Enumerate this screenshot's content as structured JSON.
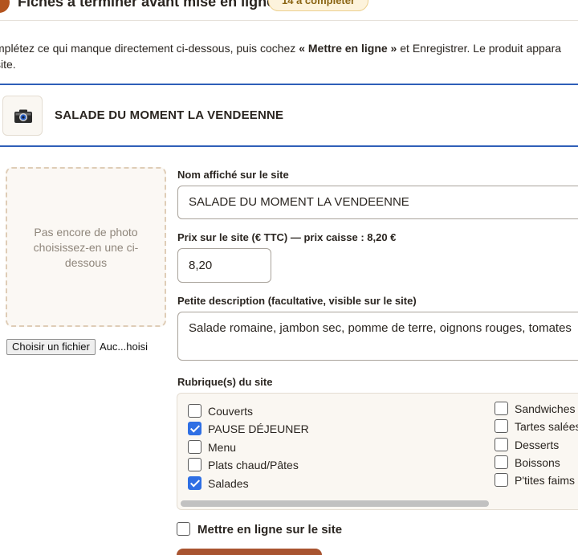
{
  "header": {
    "title": "Fiches à terminer avant mise en ligne",
    "badge": "14 à compléter"
  },
  "instructions": {
    "line1_before": "mplétez ce qui manque directement ci-dessous, puis cochez ",
    "line1_bold": "« Mettre en ligne »",
    "line1_after": " et Enregistrer. Le produit appara",
    "line2": "site."
  },
  "product": {
    "name": "SALADE DU MOMENT LA VENDEENNE",
    "icon": "camera-icon"
  },
  "photo": {
    "placeholder": "Pas encore de photo choisissez-en une ci-dessous",
    "file_button": "Choisir un fichier",
    "file_status": "Auc...hoisi"
  },
  "form": {
    "name_label": "Nom affiché sur le site",
    "name_value": "SALADE DU MOMENT LA VENDEENNE",
    "price_label": "Prix sur le site (€ TTC) — prix caisse : 8,20 €",
    "price_value": "8,20",
    "desc_label": "Petite description (facultative, visible sur le site)",
    "desc_value": "Salade romaine, jambon sec, pomme de terre, oignons rouges, tomates",
    "categories_label": "Rubrique(s) du site",
    "online_label": "Mettre en ligne sur le site",
    "online_checked": false
  },
  "categories": [
    {
      "label": "Couverts",
      "checked": false
    },
    {
      "label": "PAUSE DÉJEUNER",
      "checked": true
    },
    {
      "label": "Menu",
      "checked": false
    },
    {
      "label": "Plats chaud/Pâtes",
      "checked": false
    },
    {
      "label": "Salades",
      "checked": true
    },
    {
      "label": "Sandwiches",
      "checked": false
    },
    {
      "label": "Tartes salées",
      "checked": false
    },
    {
      "label": "Desserts",
      "checked": false
    },
    {
      "label": "Boissons",
      "checked": false
    },
    {
      "label": "P'tites faims",
      "checked": false
    }
  ],
  "colors": {
    "accent_blue": "#2f5fb8",
    "checkbox_blue": "#2f6fe4",
    "brand_brown": "#a85430",
    "badge_bg": "#fdf3dc"
  }
}
